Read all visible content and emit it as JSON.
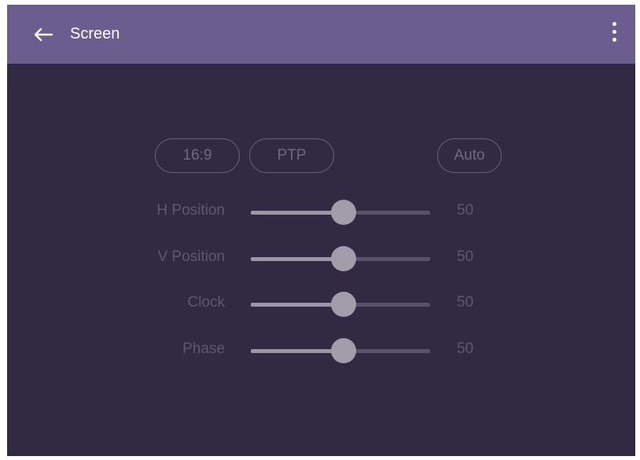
{
  "header": {
    "title": "Screen",
    "back_icon": "arrow-left-icon",
    "menu_icon": "more-vertical-icon",
    "bar_color": "#6b5d8e"
  },
  "aspect_buttons": [
    {
      "label": "16:9"
    },
    {
      "label": "PTP"
    },
    {
      "label": "Auto"
    }
  ],
  "adjustments": [
    {
      "label": "H Position",
      "value": "50",
      "level": 0.5
    },
    {
      "label": "V Position",
      "value": "50",
      "level": 0.5
    },
    {
      "label": "Clock",
      "value": "50",
      "level": 0.5
    },
    {
      "label": "Phase",
      "value": "50",
      "level": 0.5
    }
  ],
  "colors": {
    "background": "#322a42",
    "slider_thumb": "#a19daa"
  }
}
